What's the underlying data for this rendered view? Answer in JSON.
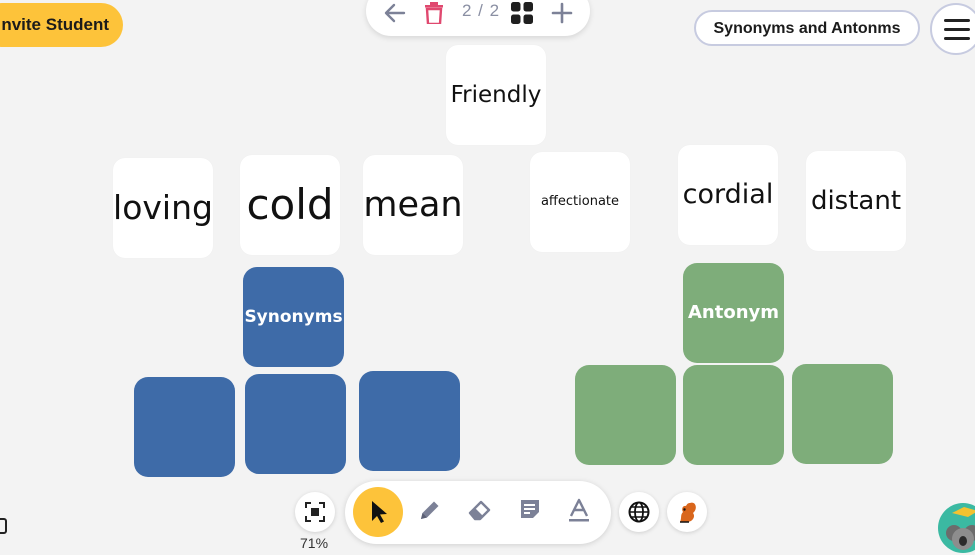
{
  "header": {
    "invite_label": "nvite Student",
    "page_indicator": "2 / 2",
    "board_title": "Synonyms and Antonms"
  },
  "cards": {
    "prompt": "Friendly",
    "words": [
      "loving",
      "cold",
      "mean",
      "affectionate",
      "cordial",
      "distant"
    ]
  },
  "categories": {
    "synonyms_label": "Synonyms",
    "antonyms_label": "Antonym"
  },
  "footer": {
    "zoom": "71%"
  },
  "colors": {
    "accent": "#fdc33a",
    "synonym_blue": "#3e6ba8",
    "antonym_green": "#7ead7a",
    "delete_red": "#e0486f"
  },
  "icons": [
    "back-arrow-icon",
    "trash-icon",
    "grid-icon",
    "plus-icon",
    "menu-icon",
    "fit-screen-icon",
    "pointer-icon",
    "pencil-icon",
    "eraser-icon",
    "sticky-note-icon",
    "text-icon",
    "globe-icon",
    "squirrel-icon",
    "mascot-icon"
  ]
}
